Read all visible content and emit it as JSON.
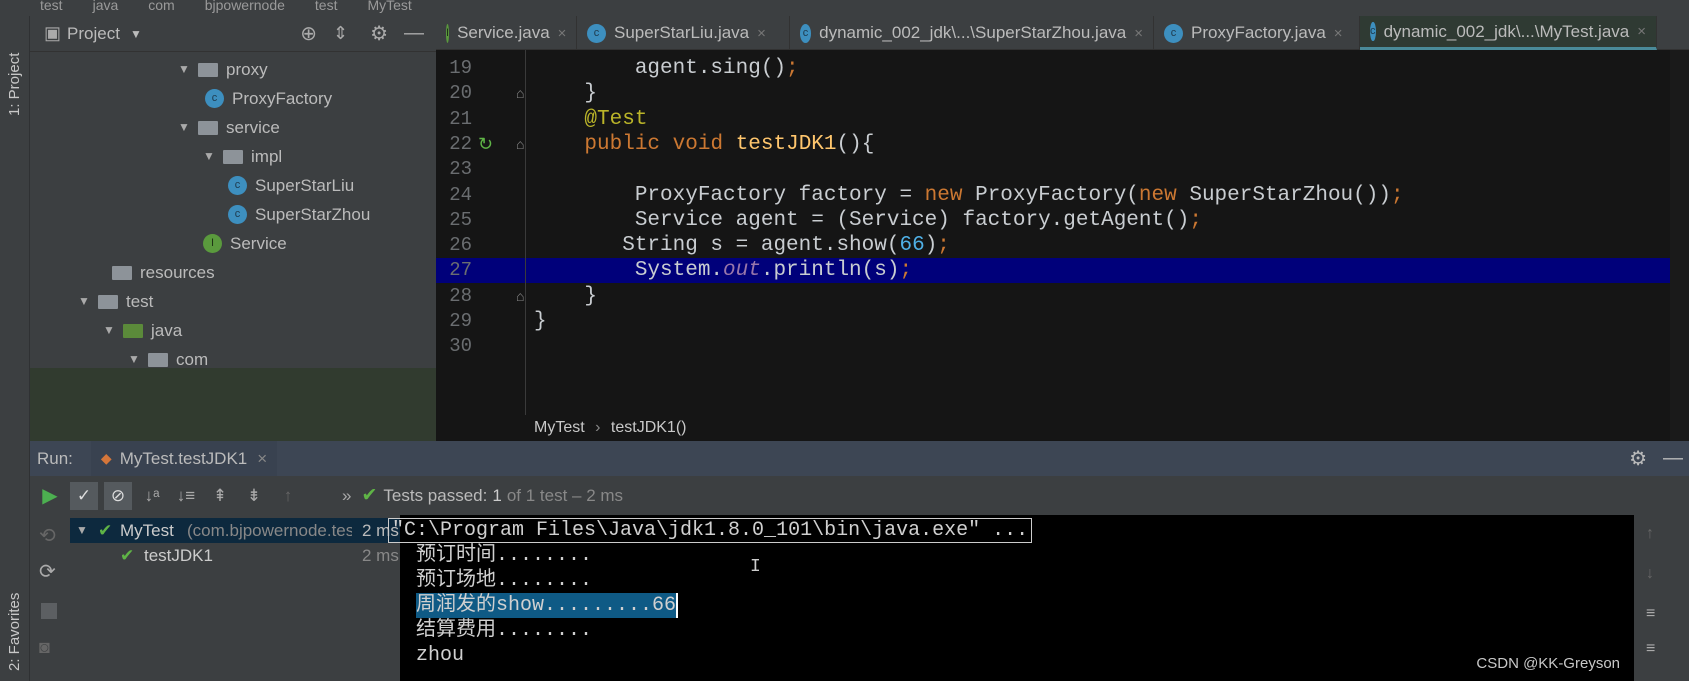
{
  "topbar": {
    "crumbs": [
      "test",
      "java",
      "com",
      "bjpowernode",
      "test",
      "MyTest"
    ]
  },
  "sidebar": {
    "project_label": "1: Project",
    "favorites_label": "2: Favorites"
  },
  "project": {
    "title": "Project",
    "tree": [
      {
        "label": "proxy",
        "type": "package",
        "expanded": true
      },
      {
        "label": "ProxyFactory",
        "type": "class"
      },
      {
        "label": "service",
        "type": "package",
        "expanded": true
      },
      {
        "label": "impl",
        "type": "package",
        "expanded": true
      },
      {
        "label": "SuperStarLiu",
        "type": "class"
      },
      {
        "label": "SuperStarZhou",
        "type": "class"
      },
      {
        "label": "Service",
        "type": "interface"
      },
      {
        "label": "resources",
        "type": "resources"
      },
      {
        "label": "test",
        "type": "folder",
        "expanded": true
      },
      {
        "label": "java",
        "type": "source-folder",
        "expanded": true
      },
      {
        "label": "com",
        "type": "package",
        "expanded": true
      },
      {
        "label": "bjpowernode",
        "type": "package",
        "expanded": true
      },
      {
        "label": "test",
        "type": "package",
        "expanded": true
      },
      {
        "label": "MyTest",
        "type": "test-class"
      }
    ]
  },
  "tabs": [
    {
      "label": "Service.java",
      "icon": "I"
    },
    {
      "label": "SuperStarLiu.java",
      "icon": "C"
    },
    {
      "label": "dynamic_002_jdk\\...\\SuperStarZhou.java",
      "icon": "C"
    },
    {
      "label": "ProxyFactory.java",
      "icon": "C"
    },
    {
      "label": "dynamic_002_jdk\\...\\MyTest.java",
      "icon": "C",
      "active": true
    }
  ],
  "editor": {
    "highlighted_line": 27,
    "lines": [
      {
        "n": "19",
        "text": "        agent.sing();"
      },
      {
        "n": "20",
        "text": "    }"
      },
      {
        "n": "21",
        "text": "    @Test"
      },
      {
        "n": "22",
        "text": "    public void testJDK1(){"
      },
      {
        "n": "23",
        "text": ""
      },
      {
        "n": "24",
        "text": "        ProxyFactory factory = new ProxyFactory(new SuperStarZhou());"
      },
      {
        "n": "25",
        "text": "        Service agent = (Service) factory.getAgent();"
      },
      {
        "n": "26",
        "text": "       String s = agent.show(66);"
      },
      {
        "n": "27",
        "text": "        System.out.println(s);"
      },
      {
        "n": "28",
        "text": "    }"
      },
      {
        "n": "29",
        "text": "}"
      },
      {
        "n": "30",
        "text": ""
      }
    ]
  },
  "breadcrumb": {
    "class": "MyTest",
    "sep": "›",
    "method": "testJDK1()"
  },
  "run": {
    "label": "Run:",
    "tab": "MyTest.testJDK1",
    "status_prefix": "Tests passed:",
    "status_count": "1",
    "status_rest": "of 1 test – 2 ms",
    "tree": [
      {
        "label": "MyTest",
        "detail": "(com.bjpowernode.tes",
        "time": "2 ms"
      },
      {
        "label": "testJDK1",
        "time": "2 ms"
      }
    ],
    "console": [
      "\"C:\\Program Files\\Java\\jdk1.8.0_101\\bin\\java.exe\" ...",
      "预订时间........",
      "预订场地........",
      "周润发的show.........66",
      "结算费用........",
      "zhou"
    ],
    "selected_console_line": 3
  },
  "watermark": "CSDN @KK-Greyson"
}
